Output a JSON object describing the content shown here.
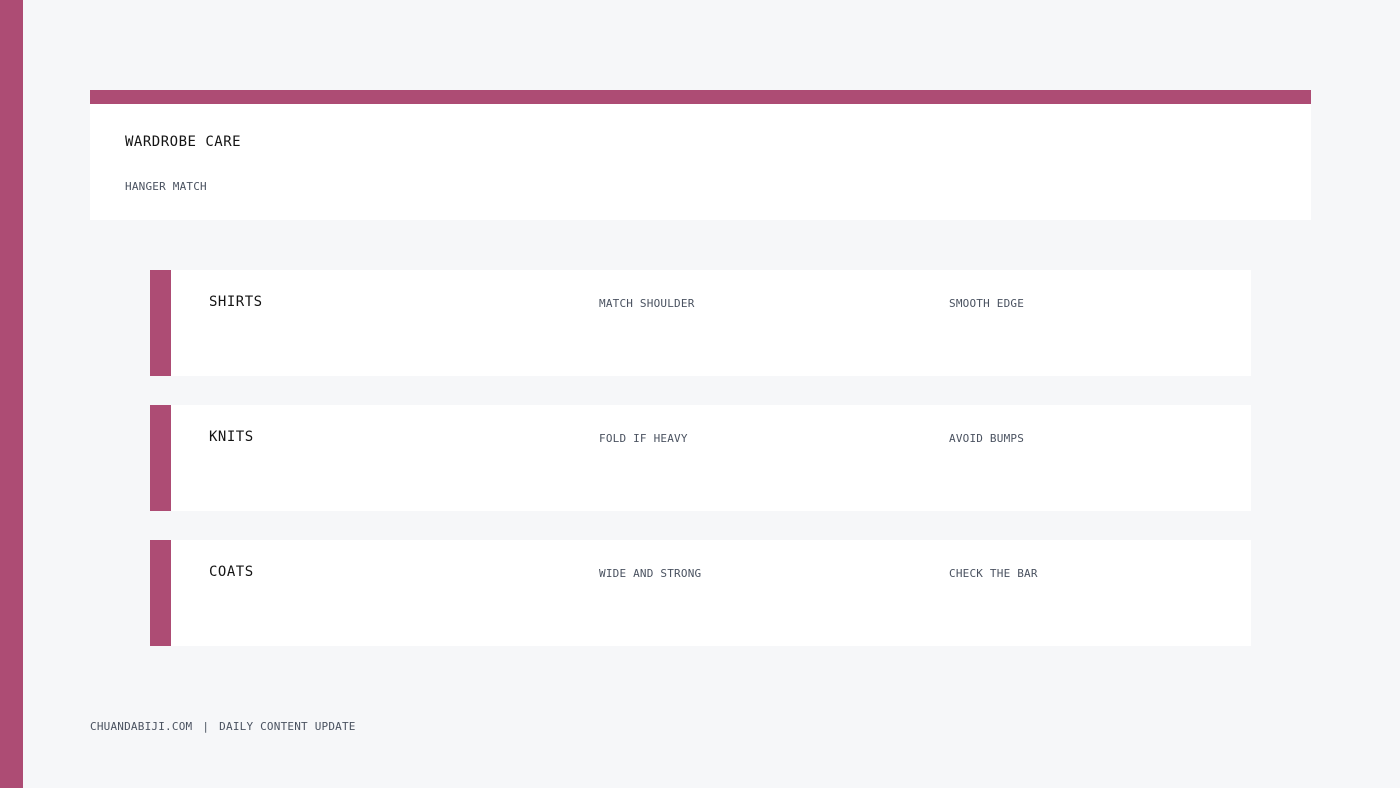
{
  "colors": {
    "accent": "#ad4c74",
    "background": "#f6f7f9",
    "card": "#ffffff",
    "muted_text": "#4a5260"
  },
  "header": {
    "title": "WARDROBE CARE",
    "subtitle": "HANGER MATCH"
  },
  "rows": [
    {
      "title": "SHIRTS",
      "tip1": "MATCH SHOULDER",
      "tip2": "SMOOTH EDGE"
    },
    {
      "title": "KNITS",
      "tip1": "FOLD IF HEAVY",
      "tip2": "AVOID BUMPS"
    },
    {
      "title": "COATS",
      "tip1": "WIDE AND STRONG",
      "tip2": "CHECK THE BAR"
    }
  ],
  "footer": {
    "site": "CHUANDABIJI.COM",
    "separator": "|",
    "tagline": "DAILY CONTENT UPDATE"
  }
}
